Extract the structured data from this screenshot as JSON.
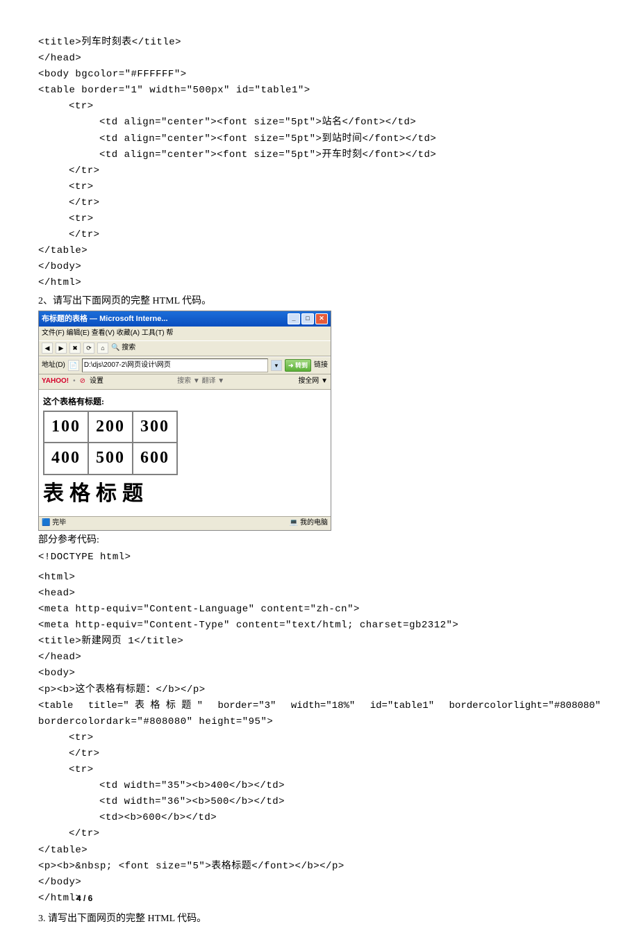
{
  "code1": {
    "l1": "<title>列车时刻表</title>",
    "l2": "</head>",
    "l3": "<body bgcolor=\"#FFFFFF\">",
    "l4": "<table border=\"1\" width=\"500px\" id=\"table1\">",
    "l5": "<tr>",
    "l6a": "<td align=\"center\"><font size=\"5pt\">站名</font></td>",
    "l6b": "<td align=\"center\"><font size=\"5pt\">到站时间</font></td>",
    "l6c": "<td align=\"center\"><font size=\"5pt\">开车时刻</font></td>",
    "l7": "</tr>",
    "l8": "<tr>",
    "l9": "</tr>",
    "l10": "<tr>",
    "l11": "</tr>",
    "l12": "</table>",
    "l13": "</body>",
    "l14": "</html>"
  },
  "q2_title": "2、请写出下面网页的完整 HTML 代码。",
  "shot": {
    "title_left": "布标题的表格 — Microsoft Interne...",
    "menu": "文件(F)  编辑(E)  查看(V)  收藏(A)  工具(T)  帮",
    "addr_label": "地址(D)",
    "addr_value": "D:\\djs\\2007-2\\网页设计\\网页",
    "go": "转到",
    "link": "链接",
    "yahoo": "YAHOO!",
    "yh_set": "设置",
    "yh_search": "搜索 ▼ 翻译 ▼",
    "yh_right": "搜全网 ▼",
    "body_p": "这个表格有标题:",
    "t_r1": [
      "100",
      "200",
      "300"
    ],
    "t_r2": [
      "400",
      "500",
      "600"
    ],
    "caption": "表格标题",
    "status_left": "完毕",
    "status_right": "我的电脑"
  },
  "ref_label": "部分参考代码:",
  "code2": {
    "l1": "<!DOCTYPE html>",
    "l2": "<html>",
    "l3": "<head>",
    "l4": "<meta http-equiv=\"Content-Language\" content=\"zh-cn\">",
    "l5": "<meta http-equiv=\"Content-Type\" content=\"text/html; charset=gb2312\">",
    "l6": "<title>新建网页 1</title>",
    "l7": "</head>",
    "l8": "<body>",
    "l9": "<p><b>这个表格有标题：</b></p>",
    "l10a": "<table ",
    "l10b": "title=\" 表 格 标 题 \" ",
    "l10c": "border=\"3\" ",
    "l10d": "width=\"18%\" ",
    "l10e": "id=\"table1\" ",
    "l10f": "bordercolorlight=\"#808080\"",
    "l11": "bordercolordark=\"#808080\" height=\"95\">",
    "l12": "<tr>",
    "l13": "</tr>",
    "l14": "<tr>",
    "l15": "<td width=\"35\"><b>400</b></td>",
    "l16": "<td width=\"36\"><b>500</b></td>",
    "l17": "<td><b>600</b></td>",
    "l18": "</tr>",
    "l19": "</table>",
    "l20": "<p><b>&nbsp; <font size=\"5\">表格标题</font></b></p>",
    "l21": "</body>",
    "l22": "</html>"
  },
  "q3_title": "3. 请写出下面网页的完整 HTML 代码。",
  "page_num": "4 / 6"
}
